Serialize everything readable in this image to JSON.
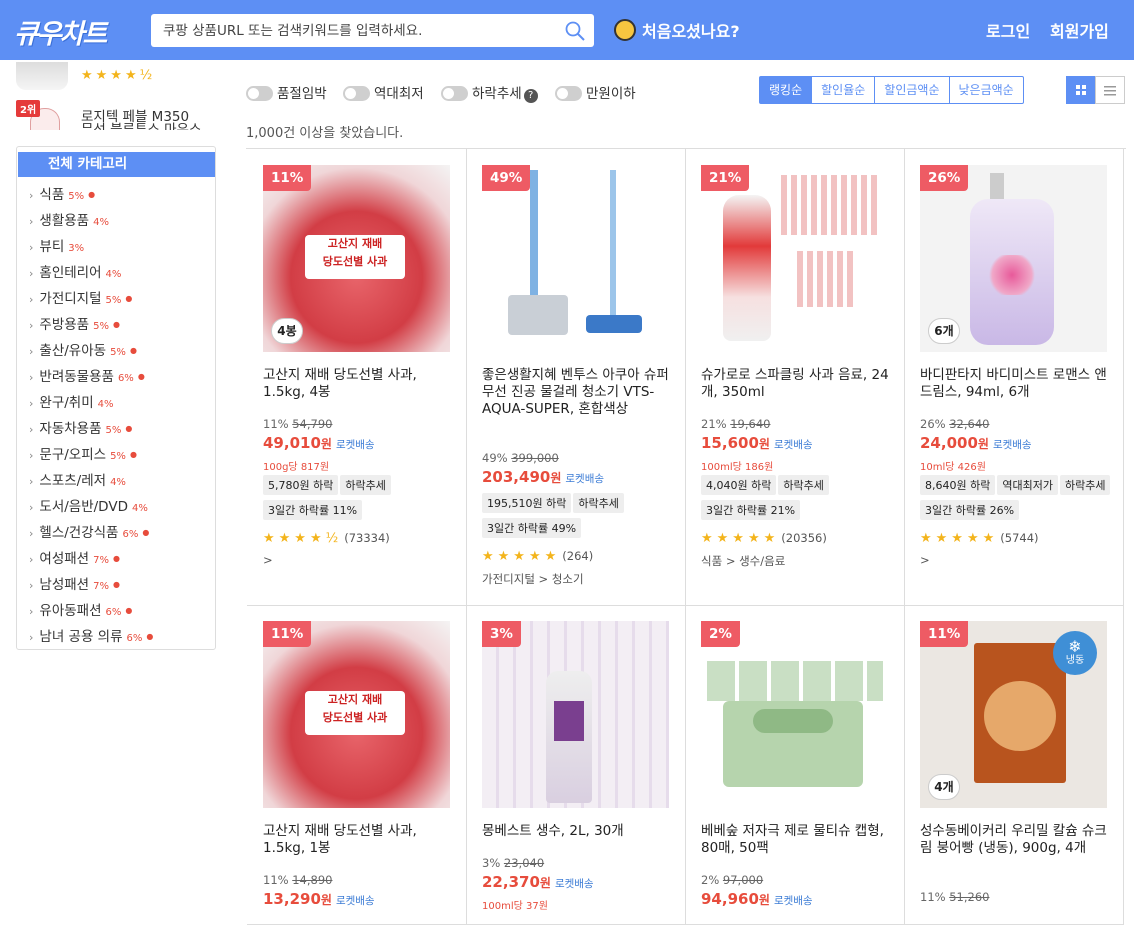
{
  "header": {
    "logo": "큐우차트",
    "search_placeholder": "쿠팡 상품URL 또는 검색키워드를 입력하세요.",
    "first_visit": "처음오셨나요?",
    "login": "로그인",
    "signup": "회원가입"
  },
  "sidebar": {
    "rank1_stars": "★★★★½",
    "rank2_badge": "2위",
    "rank2_name": "로지텍 페블 M350",
    "rank2_sub": "무선 블루투스 마우스",
    "category_title": "전체 카테고리",
    "categories": [
      {
        "label": "식품",
        "pct": "5%",
        "dot": true
      },
      {
        "label": "생활용품",
        "pct": "4%",
        "dot": false
      },
      {
        "label": "뷰티",
        "pct": "3%",
        "dot": false
      },
      {
        "label": "홈인테리어",
        "pct": "4%",
        "dot": false
      },
      {
        "label": "가전디지털",
        "pct": "5%",
        "dot": true
      },
      {
        "label": "주방용품",
        "pct": "5%",
        "dot": true
      },
      {
        "label": "출산/유아동",
        "pct": "5%",
        "dot": true
      },
      {
        "label": "반려동물용품",
        "pct": "6%",
        "dot": true
      },
      {
        "label": "완구/취미",
        "pct": "4%",
        "dot": false
      },
      {
        "label": "자동차용품",
        "pct": "5%",
        "dot": true
      },
      {
        "label": "문구/오피스",
        "pct": "5%",
        "dot": true
      },
      {
        "label": "스포츠/레저",
        "pct": "4%",
        "dot": false
      },
      {
        "label": "도서/음반/DVD",
        "pct": "4%",
        "dot": false
      },
      {
        "label": "헬스/건강식품",
        "pct": "6%",
        "dot": true
      },
      {
        "label": "여성패션",
        "pct": "7%",
        "dot": true
      },
      {
        "label": "남성패션",
        "pct": "7%",
        "dot": true
      },
      {
        "label": "유아동패션",
        "pct": "6%",
        "dot": true
      },
      {
        "label": "남녀 공용 의류",
        "pct": "6%",
        "dot": true
      }
    ]
  },
  "filters": {
    "t1": "품절임박",
    "t2": "역대최저",
    "t3": "하락추세",
    "t4": "만원이하",
    "help": "?",
    "sort": [
      "랭킹순",
      "할인율순",
      "할인금액순",
      "낮은금액순"
    ]
  },
  "result_text": "1,000건 이상을 찾았습니다.",
  "products": {
    "p1": {
      "disc": "11%",
      "count": "4봉",
      "name": "고산지 재배 당도선별 사과, 1.5kg, 4봉",
      "pct": "11%",
      "orig": "54,790",
      "price": "49,010",
      "won": "원",
      "rocket": "로켓배송",
      "unit": "100g당 817원",
      "tags": [
        "5,780원 하락",
        "하락추세",
        "3일간 하락률 11%"
      ],
      "stars": "★★★★½",
      "reviews": "(73334)",
      "cat": ">"
    },
    "p2": {
      "disc": "49%",
      "name": "좋은생활지혜 벤투스 아쿠아 슈퍼 무선 진공 물걸레 청소기 VTS-AQUA-SUPER, 혼합색상",
      "pct": "49%",
      "orig": "399,000",
      "price": "203,490",
      "won": "원",
      "rocket": "로켓배송",
      "tags": [
        "195,510원 하락",
        "하락추세",
        "3일간 하락률 49%"
      ],
      "stars": "★★★★★",
      "reviews": "(264)",
      "cat": "가전디지털 > 청소기"
    },
    "p3": {
      "disc": "21%",
      "name": "슈가로로 스파클링 사과 음료, 24개, 350ml",
      "pct": "21%",
      "orig": "19,640",
      "price": "15,600",
      "won": "원",
      "rocket": "로켓배송",
      "unit": "100ml당 186원",
      "tags": [
        "4,040원 하락",
        "하락추세",
        "3일간 하락률 21%"
      ],
      "stars": "★★★★★",
      "reviews": "(20356)",
      "cat": "식품 > 생수/음료"
    },
    "p4": {
      "disc": "26%",
      "count": "6개",
      "name": "바디판타지 바디미스트 로맨스 앤 드림스, 94ml, 6개",
      "pct": "26%",
      "orig": "32,640",
      "price": "24,000",
      "won": "원",
      "rocket": "로켓배송",
      "unit": "10ml당 426원",
      "tags": [
        "8,640원 하락",
        "역대최저가",
        "하락추세",
        "3일간 하락률 26%"
      ],
      "stars": "★★★★★",
      "reviews": "(5744)",
      "cat": ">"
    },
    "p5": {
      "disc": "11%",
      "name": "고산지 재배 당도선별 사과, 1.5kg, 1봉",
      "pct": "11%",
      "orig": "14,890",
      "price": "13,290",
      "won": "원",
      "rocket": "로켓배송"
    },
    "p6": {
      "disc": "3%",
      "name": "몽베스트 생수, 2L, 30개",
      "pct": "3%",
      "orig": "23,040",
      "price": "22,370",
      "won": "원",
      "rocket": "로켓배송",
      "unit": "100ml당 37원"
    },
    "p7": {
      "disc": "2%",
      "name": "베베숲 저자극 제로 물티슈 캡형, 80매, 50팩",
      "pct": "2%",
      "orig": "97,000",
      "price": "94,960",
      "won": "원",
      "rocket": "로켓배송"
    },
    "p8": {
      "disc": "11%",
      "count": "4개",
      "frozen": "냉동",
      "name": "성수동베이커리 우리밀 칼슘 슈크림 붕어빵 (냉동), 900g, 4개",
      "pct": "11%",
      "orig": "51,260"
    }
  }
}
